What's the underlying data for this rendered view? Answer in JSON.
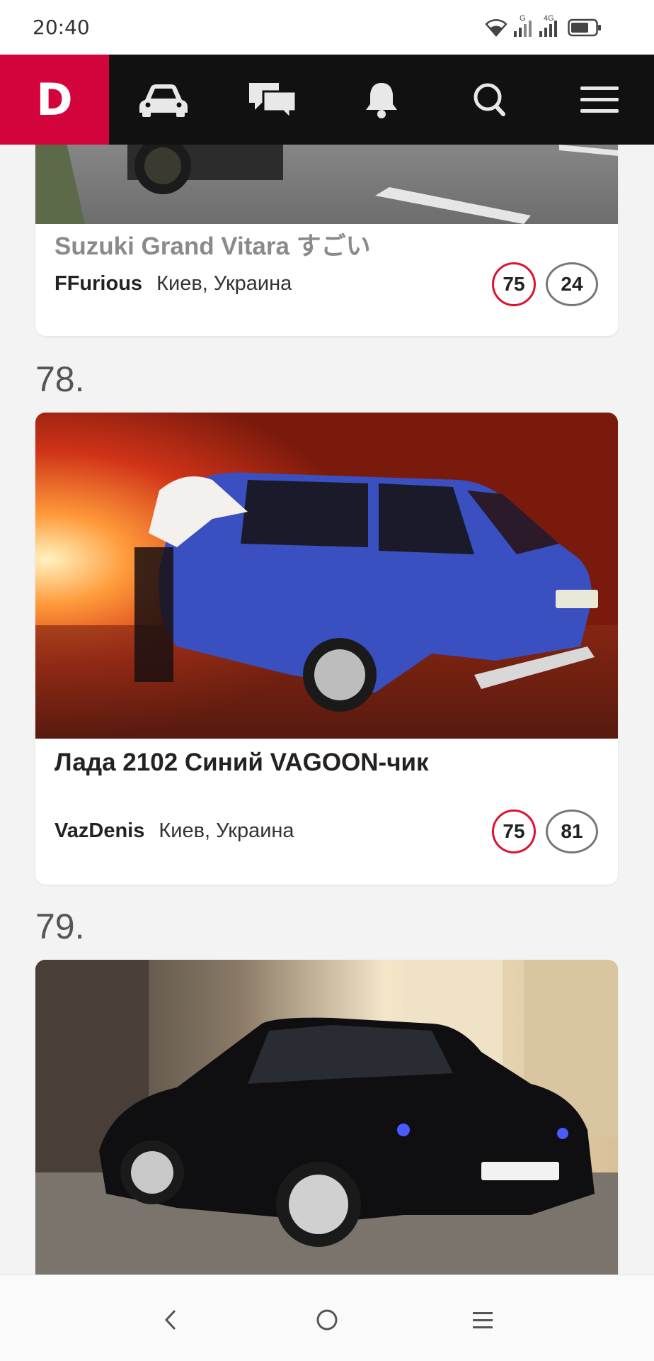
{
  "status_bar": {
    "time": "20:40",
    "net_g": "G",
    "net_4g": "4G",
    "icons": [
      "wifi-icon",
      "signal-icon",
      "signal-icon",
      "battery-icon"
    ]
  },
  "nav": {
    "logo": "D",
    "items": [
      "car-icon",
      "chat-icon",
      "bell-icon",
      "search-icon",
      "menu-icon"
    ]
  },
  "feed": {
    "items": [
      {
        "title": "Suzuki Grand Vitara すごい",
        "author": "FFurious",
        "location": "Киев, Украина",
        "rating": "75",
        "comments": "24"
      },
      {
        "rank": "78.",
        "title": "Лада 2102 Синий VAGOON-чик",
        "author": "VazDenis",
        "location": "Киев, Украина",
        "rating": "75",
        "comments": "81"
      },
      {
        "rank": "79."
      }
    ]
  },
  "system_nav": {
    "icons": [
      "back-icon",
      "home-icon",
      "recents-icon"
    ]
  },
  "colors": {
    "brand": "#d3043c",
    "nav_bg": "#111111",
    "rating_ring": "#e0102f"
  }
}
